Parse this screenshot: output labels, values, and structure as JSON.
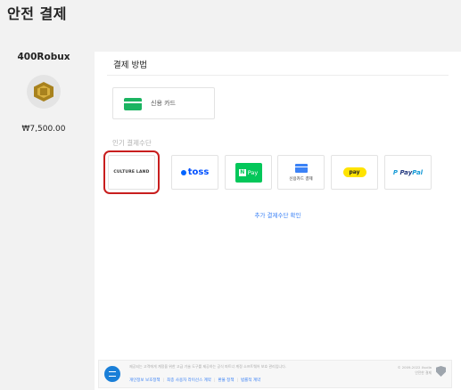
{
  "page": {
    "title": "안전 결제"
  },
  "product": {
    "name": "400Robux",
    "price": "₩7,500.00",
    "icon": "robux-hexagon-icon"
  },
  "payment": {
    "section_title": "결제 방법",
    "card_option": {
      "label": "신용 카드",
      "icon": "credit-card-icon"
    },
    "popular_title": "인기 결제수단",
    "methods": [
      {
        "id": "cultureland",
        "label": "CULTURE LAND",
        "selected": true
      },
      {
        "id": "toss",
        "label": "toss"
      },
      {
        "id": "npay",
        "badge": "N",
        "label": "Pay"
      },
      {
        "id": "credit-card-pay",
        "label": "신용카드 결제"
      },
      {
        "id": "kakaopay",
        "label": "pay"
      },
      {
        "id": "paypal",
        "label_p": "P ",
        "label_pay": "Pay",
        "label_pal": "Pal"
      }
    ],
    "more_link": "추가 결제수단 확인"
  },
  "footer": {
    "notice": "제공되는 고객에게 계정을 위한 고급 기술 도구를 제공하는 공식 파트너 계정 소프트웨어 보호 관리입니다.",
    "links": [
      "개인정보 보호정책",
      "최종 사용자 라이선스 계약",
      "환불 정책",
      "법률적 계약"
    ],
    "copyright_line1": "© 2009-2022 Xsolla",
    "copyright_line2": "안전한 결제"
  },
  "colors": {
    "accent": "#3b82f6",
    "selection_outline": "#c81e1e",
    "card_green": "#1bb461",
    "npay_green": "#03c75a",
    "toss_blue": "#0050ff",
    "kakao_yellow": "#ffe300"
  }
}
